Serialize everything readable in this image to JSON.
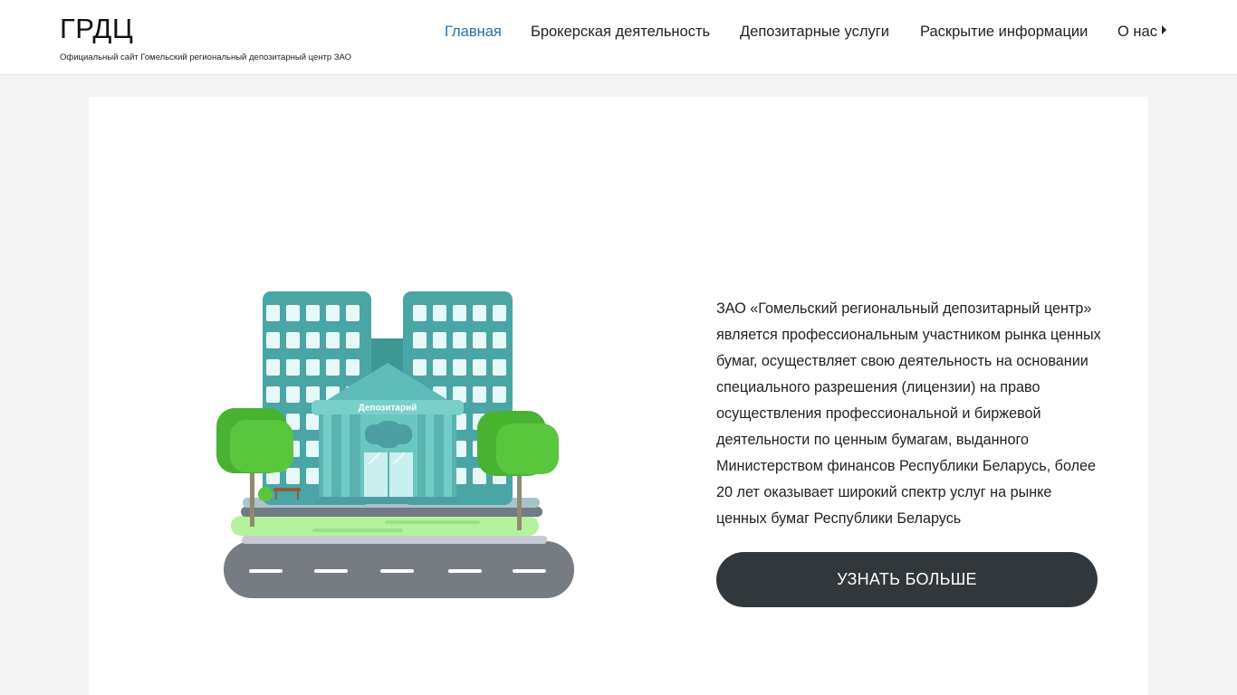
{
  "site": {
    "title": "ГРДЦ",
    "tagline": "Официальный сайт Гомельский региональный депозитарный центр ЗАО"
  },
  "nav": {
    "items": [
      {
        "label": "Главная",
        "active": true
      },
      {
        "label": "Брокерская деятельность",
        "active": false
      },
      {
        "label": "Депозитарные услуги",
        "active": false
      },
      {
        "label": "Раскрытие информации",
        "active": false
      },
      {
        "label": "О нас",
        "active": false,
        "has_submenu": true,
        "icon": "caret-right-icon"
      }
    ]
  },
  "hero": {
    "illustration": {
      "building_sign": "Депозитарий"
    },
    "text": "ЗАО «Гомельский региональный депозитарный центр» является профессиональным участником рынка ценных бумаг, осуществляет свою деятельность на основании специального разрешения  (лицензии) на право осуществления профессиональной и биржевой деятельности по ценным бумагам, выданного Министерством финансов Республики Беларусь, более 20 лет оказывает широкий спектр услуг на рынке ценных бумаг Республики Беларусь",
    "button_label": "УЗНАТЬ БОЛЬШЕ"
  },
  "colors": {
    "accent_link": "#2a6fa8",
    "button_bg": "#32373b",
    "page_bg": "#f4f4f4",
    "building_teal": "#4aa6a4",
    "tree_green": "#5ac63e",
    "road_gray": "#777b82"
  }
}
